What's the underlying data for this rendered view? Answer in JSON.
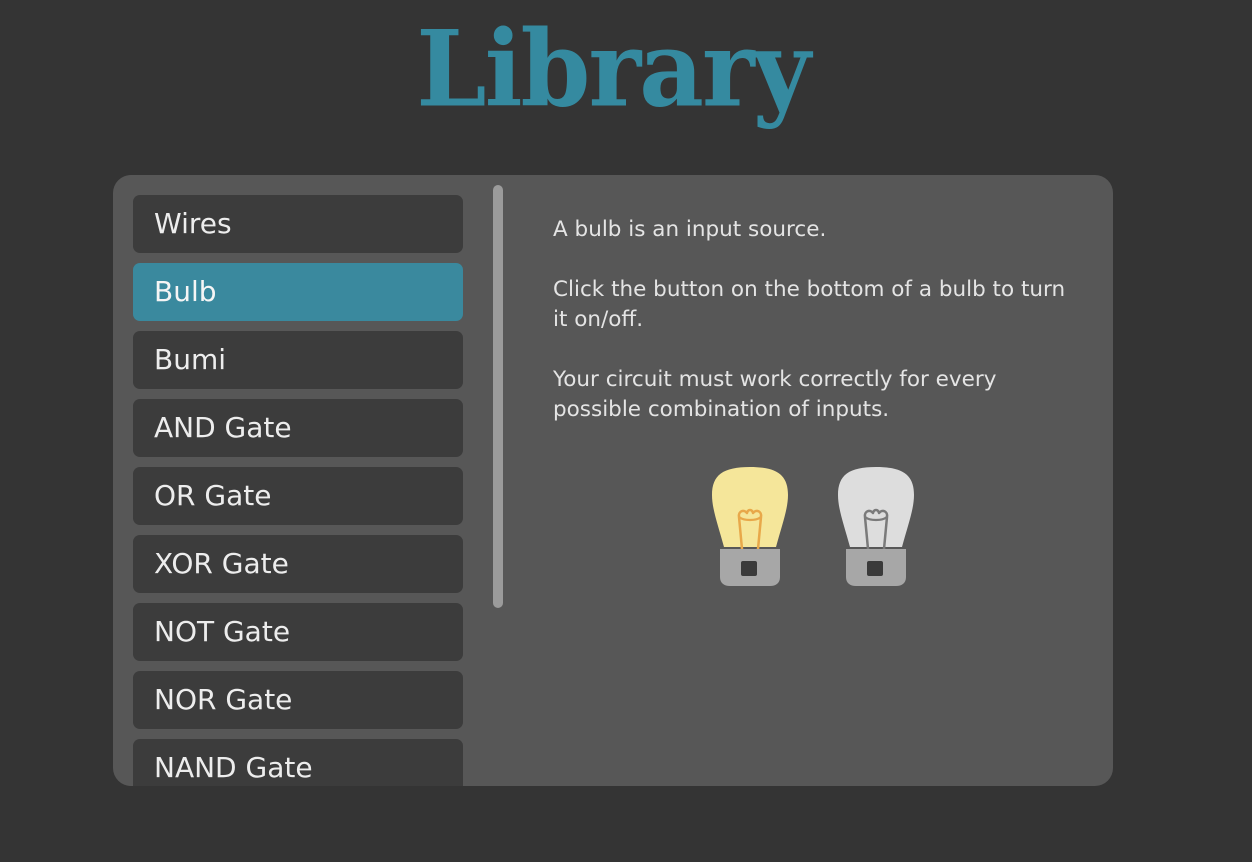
{
  "header": {
    "title": "Library"
  },
  "sidebar": {
    "items": [
      {
        "label": "Wires",
        "selected": false
      },
      {
        "label": "Bulb",
        "selected": true
      },
      {
        "label": "Bumi",
        "selected": false
      },
      {
        "label": "AND Gate",
        "selected": false
      },
      {
        "label": "OR Gate",
        "selected": false
      },
      {
        "label": "XOR Gate",
        "selected": false
      },
      {
        "label": "NOT Gate",
        "selected": false
      },
      {
        "label": "NOR Gate",
        "selected": false
      },
      {
        "label": "NAND Gate",
        "selected": false
      }
    ]
  },
  "content": {
    "paragraphs": [
      "A bulb is an input source.",
      "Click the button on the bottom of a bulb to turn it on/off.",
      "Your circuit must work correctly for every possible combination of inputs."
    ],
    "illustrations": [
      {
        "icon": "bulb-on-icon",
        "state": "on"
      },
      {
        "icon": "bulb-off-icon",
        "state": "off"
      }
    ]
  },
  "colors": {
    "background": "#343434",
    "panel": "#575757",
    "item": "#3c3c3c",
    "accent": "#3a899e",
    "title": "#358aa0",
    "bulb_on_glass": "#f5e69a",
    "bulb_on_filament": "#e8a84a",
    "bulb_off_glass": "#dddddd",
    "bulb_off_filament": "#7a7a7a",
    "bulb_base": "#a7a7a7"
  }
}
